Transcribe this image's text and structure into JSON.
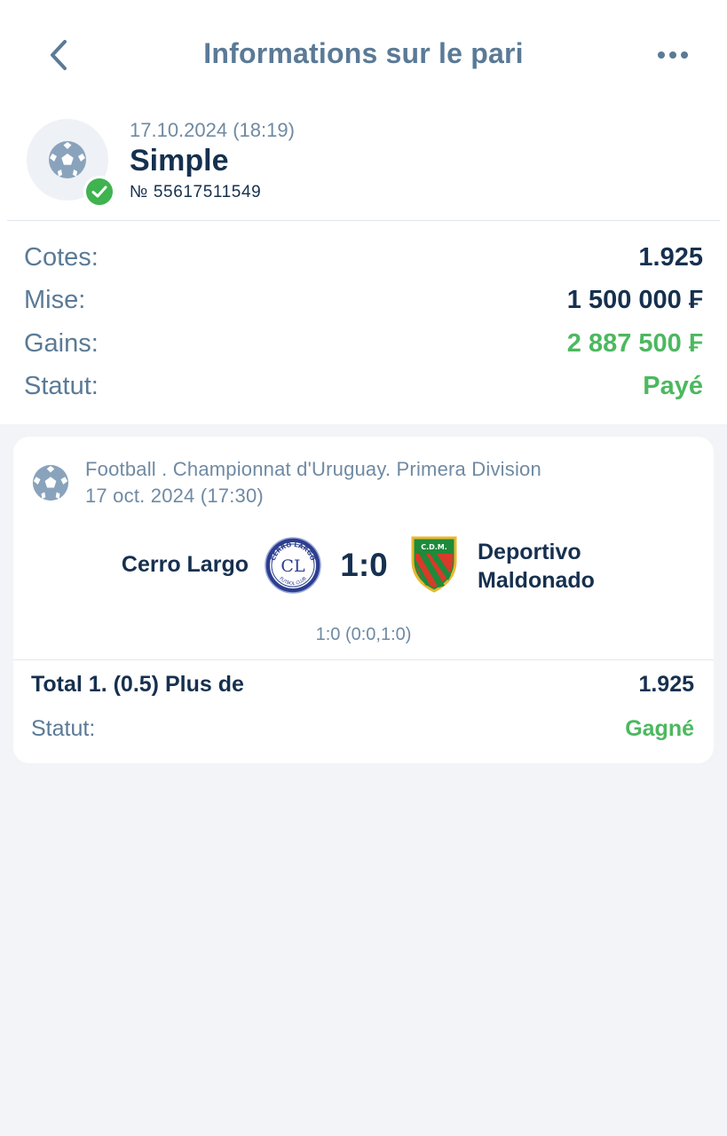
{
  "colors": {
    "title": "#5a7a96",
    "text_dark": "#16304f",
    "muted": "#6f8aa3",
    "success_green": "#4cb85f",
    "check_badge": "#3fb34f",
    "background": "#f2f4f8"
  },
  "header": {
    "title": "Informations sur le pari",
    "back_icon": "chevron-left-icon",
    "more_icon": "more-horizontal-icon"
  },
  "bet": {
    "date": "17.10.2024 (18:19)",
    "type": "Simple",
    "number": "№ 55617511549",
    "icon": "soccer-ball-icon",
    "badge_icon": "checkmark-icon"
  },
  "summary": [
    {
      "label": "Cotes:",
      "value": "1.925"
    },
    {
      "label": "Mise:",
      "value": "1 500 000 ₣"
    },
    {
      "label": "Gains:",
      "value": "2 887 500 ₣"
    },
    {
      "label": "Statut:",
      "value": "Payé"
    }
  ],
  "event": {
    "league": "Football . Championnat d'Uruguay. Primera Division",
    "date": "17 oct. 2024 (17:30)",
    "home_team": "Cerro Largo",
    "away_team_line1": "Deportivo",
    "away_team_line2": "Maldonado",
    "score": "1:0",
    "halftime_score": "1:0 (0:0,1:0)",
    "home_logo_text": "CL",
    "home_logo_top_text": "CERRO LARGO",
    "home_logo_bottom_text": "FUTBOL CLUB",
    "away_logo_text": "C.D.M."
  },
  "selection": {
    "market": "Total 1. (0.5) Plus de",
    "odd": "1.925",
    "status_label": "Statut:",
    "status_value": "Gagné"
  }
}
